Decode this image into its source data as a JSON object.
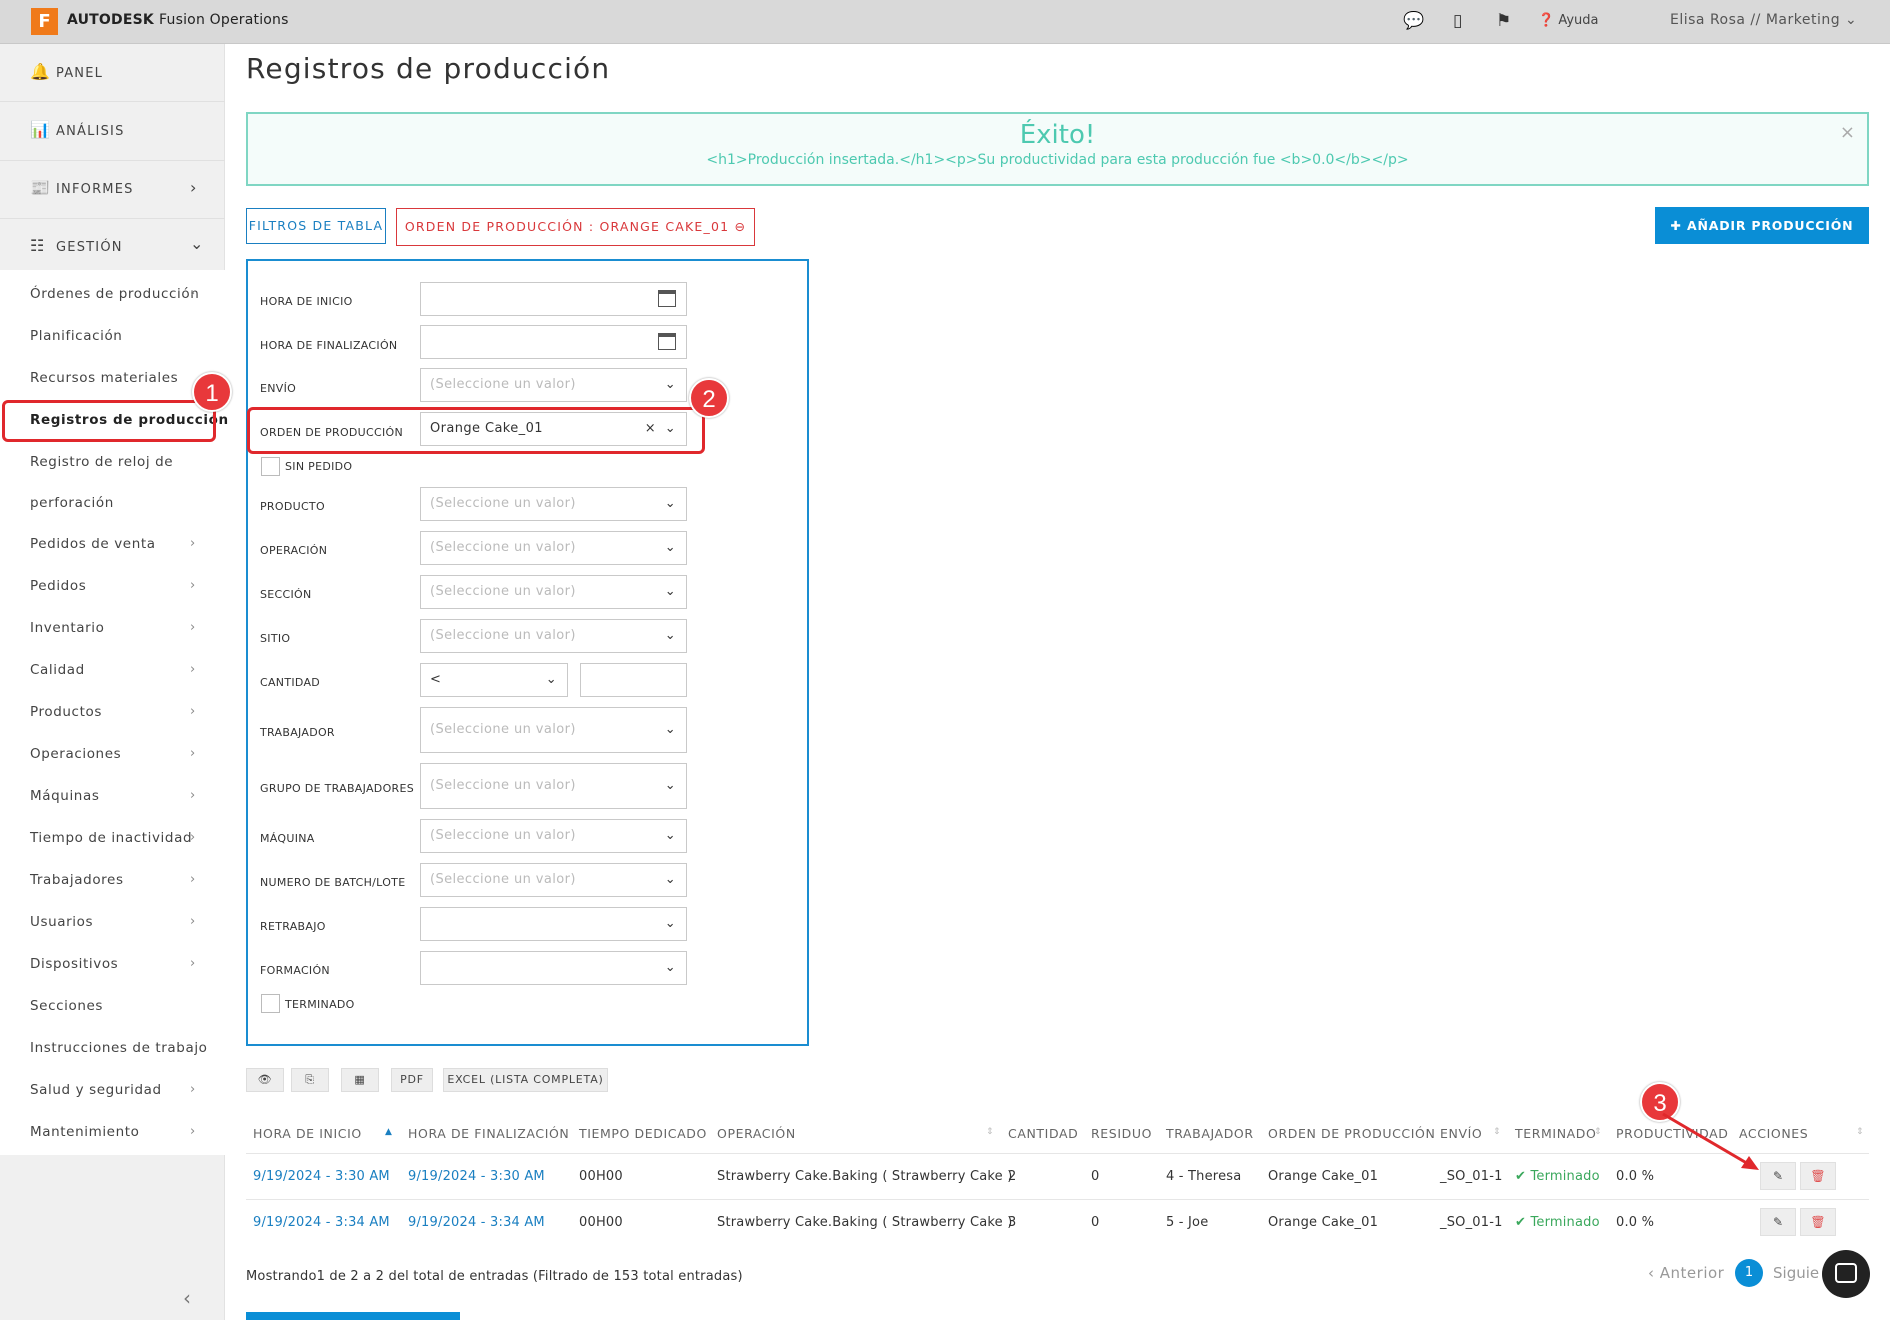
{
  "topbar": {
    "logo_letter": "F",
    "brand_bold": "AUTODESK",
    "brand_sub": "Fusion Operations",
    "help_label": "Ayuda",
    "user_label": "Elisa Rosa // Marketing"
  },
  "sidebar": {
    "main": [
      {
        "label": "PANEL"
      },
      {
        "label": "ANÁLISIS"
      },
      {
        "label": "INFORMES"
      },
      {
        "label": "GESTIÓN"
      }
    ],
    "items": [
      {
        "label": "Órdenes de producción"
      },
      {
        "label": "Planificación"
      },
      {
        "label": "Recursos materiales"
      },
      {
        "label": "Registros de producción"
      },
      {
        "label": "Registro de reloj de"
      },
      {
        "label": "perforación"
      },
      {
        "label": "Pedidos de venta"
      },
      {
        "label": "Pedidos"
      },
      {
        "label": "Inventario"
      },
      {
        "label": "Calidad"
      },
      {
        "label": "Productos"
      },
      {
        "label": "Operaciones"
      },
      {
        "label": "Máquinas"
      },
      {
        "label": "Tiempo de inactividad"
      },
      {
        "label": "Trabajadores"
      },
      {
        "label": "Usuarios"
      },
      {
        "label": "Dispositivos"
      },
      {
        "label": "Secciones"
      },
      {
        "label": "Instrucciones de trabajo"
      },
      {
        "label": "Salud y seguridad"
      },
      {
        "label": "Mantenimiento"
      }
    ]
  },
  "page": {
    "title": "Registros de producción",
    "alert_title": "Éxito!",
    "alert_body": "<h1>Producción insertada.</h1><p>Su productividad para esta producción fue <b>0.0</b></p>",
    "alert_close": "×",
    "filter_button": "FILTROS DE TABLA",
    "order_chip": "ORDEN DE PRODUCCIÓN : ORANGE CAKE_01",
    "add_button": "AÑADIR PRODUCCIÓN"
  },
  "filters": {
    "start_label": "HORA DE INICIO",
    "end_label": "HORA DE FINALIZACIÓN",
    "shipment_label": "ENVÍO",
    "order_label": "ORDEN DE PRODUCCIÓN",
    "order_value": "Orange Cake_01",
    "no_order_label": "SIN PEDIDO",
    "product_label": "PRODUCTO",
    "operation_label": "OPERACIÓN",
    "section_label": "SECCIÓN",
    "site_label": "SITIO",
    "quantity_label": "CANTIDAD",
    "quantity_op": "<",
    "worker_label": "TRABAJADOR",
    "worker_group_label": "GRUPO DE TRABAJADORES",
    "machine_label": "MÁQUINA",
    "batch_label": "NUMERO DE BATCH/LOTE",
    "rework_label": "RETRABAJO",
    "training_label": "FORMACIÓN",
    "finished_label": "TERMINADO",
    "placeholder": "(Seleccione un valor)"
  },
  "toolbar": {
    "pdf": "PDF",
    "excel": "EXCEL (LISTA COMPLETA)"
  },
  "table": {
    "headers": [
      "HORA DE INICIO",
      "HORA DE FINALIZACIÓN",
      "TIEMPO DEDICADO",
      "OPERACIÓN",
      "CANTIDAD",
      "RESIDUO",
      "TRABAJADOR",
      "ORDEN DE PRODUCCIÓN",
      "ENVÍO",
      "TERMINADO",
      "PRODUCTIVIDAD",
      "ACCIONES"
    ],
    "rows": [
      {
        "start": "9/19/2024 - 3:30 AM",
        "end": "9/19/2024 - 3:30 AM",
        "time": "00H00",
        "operation": "Strawberry Cake.Baking ( Strawberry Cake )",
        "qty": "2",
        "waste": "0",
        "worker": "4 - Theresa",
        "order": "Orange Cake_01",
        "shipment": "_SO_01-1",
        "finished": "Terminado",
        "productivity": "0.0 %"
      },
      {
        "start": "9/19/2024 - 3:34 AM",
        "end": "9/19/2024 - 3:34 AM",
        "time": "00H00",
        "operation": "Strawberry Cake.Baking ( Strawberry Cake )",
        "qty": "3",
        "waste": "0",
        "worker": "5 - Joe",
        "order": "Orange Cake_01",
        "shipment": "_SO_01-1",
        "finished": "Terminado",
        "productivity": "0.0 %"
      }
    ]
  },
  "footer": {
    "info": "Mostrando1 de 2 a 2 del total de entradas (Filtrado de 153 total entradas)",
    "prev": "Anterior",
    "page": "1",
    "next": "Siguie"
  },
  "annotations": {
    "one": "1",
    "two": "2",
    "three": "3"
  },
  "colors": {
    "accent": "#0a8ed6",
    "highlight": "#e0282c",
    "success": "#4dc9b0"
  }
}
